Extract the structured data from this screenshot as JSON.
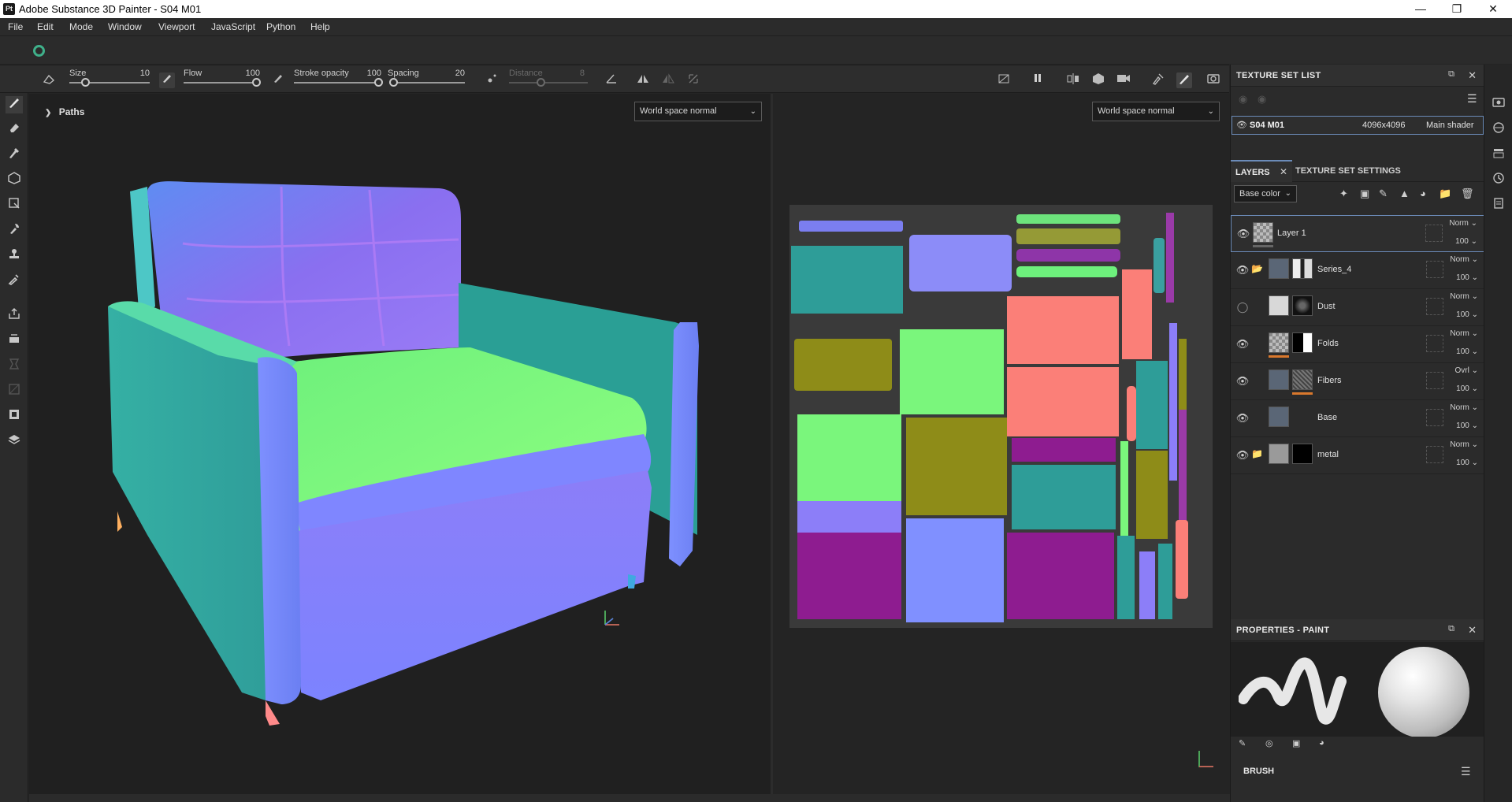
{
  "window": {
    "title": "Adobe Substance 3D Painter - S04 M01",
    "app_icon": "Pt",
    "minimize": "—",
    "maximize": "❐",
    "close": "✕"
  },
  "menu": [
    "File",
    "Edit",
    "Mode",
    "Window",
    "Viewport",
    "JavaScript",
    "Python",
    "Help"
  ],
  "toolbar": {
    "size_label": "Size",
    "size_value": "10",
    "size_fraction": 0.2,
    "flow_label": "Flow",
    "flow_value": "100",
    "flow_fraction": 1.0,
    "stroke_opacity_label": "Stroke opacity",
    "stroke_opacity_value": "100",
    "stroke_opacity_fraction": 1.0,
    "spacing_label": "Spacing",
    "spacing_value": "20",
    "spacing_fraction": 0.05,
    "distance_label": "Distance",
    "distance_value": "8",
    "distance_fraction": 0.4
  },
  "paths": {
    "label": "Paths"
  },
  "viewport3d": {
    "mode": "World space normal"
  },
  "viewport2d": {
    "mode": "World space normal"
  },
  "texture_set_list": {
    "title": "TEXTURE SET LIST",
    "item_name": "S04 M01",
    "item_resolution": "4096x4096",
    "item_shader": "Main shader"
  },
  "layers_panel": {
    "tab_layers": "LAYERS",
    "tab_settings": "TEXTURE SET SETTINGS",
    "channel": "Base color",
    "layers": [
      {
        "name": "Layer 1",
        "blend": "Norm",
        "opacity": "100",
        "visible": true,
        "type": "paint"
      },
      {
        "name": "Series_4",
        "blend": "Norm",
        "opacity": "100",
        "visible": true,
        "type": "folder"
      },
      {
        "name": "Dust",
        "blend": "Norm",
        "opacity": "100",
        "visible": false,
        "type": "fill"
      },
      {
        "name": "Folds",
        "blend": "Norm",
        "opacity": "100",
        "visible": true,
        "type": "fill"
      },
      {
        "name": "Fibers",
        "blend": "Ovrl",
        "opacity": "100",
        "visible": true,
        "type": "fill"
      },
      {
        "name": "Base",
        "blend": "Norm",
        "opacity": "100",
        "visible": true,
        "type": "fill"
      },
      {
        "name": "metal",
        "blend": "Norm",
        "opacity": "100",
        "visible": true,
        "type": "folder"
      }
    ]
  },
  "properties": {
    "title": "PROPERTIES - PAINT",
    "brush_label": "BRUSH"
  },
  "colors": {
    "accent_blue": "#6b8bb8",
    "orange_bar": "#d9782d"
  }
}
